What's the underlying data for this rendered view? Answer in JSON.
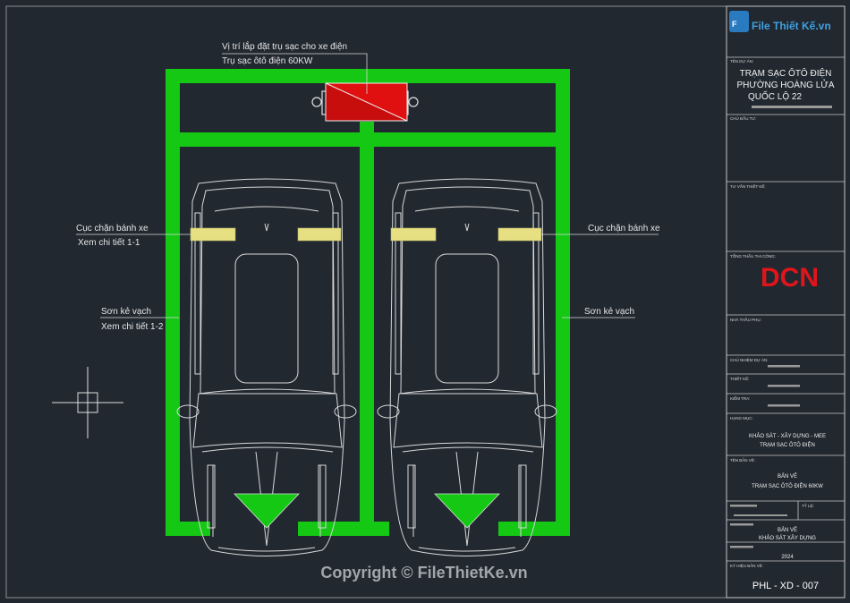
{
  "labels": {
    "charger_location": "Vị trí lắp đặt trụ sạc cho xe điện",
    "charger_spec": "Trụ sạc ôtô điện 60KW",
    "wheel_stop_left": "Cục chặn bánh xe",
    "wheel_stop_left_ref": "Xem chi tiết 1-1",
    "wheel_stop_right": "Cục chặn bánh xe",
    "paint_left": "Sơn kẻ vạch",
    "paint_left_ref": "Xem chi tiết 1-2",
    "paint_right": "Sơn kẻ vạch"
  },
  "title_block": {
    "logo_text": "File Thiết Kế.vn",
    "project_caption": "TÊN DỰ ÁN:",
    "project_line1": "TRẠM SẠC ÔTÔ ĐIỆN",
    "project_line2": "PHƯỜNG HOÀNG LỬA",
    "project_line3": "QUỐC LỘ 22",
    "investor_caption": "CHỦ ĐẦU TƯ:",
    "consultant_caption": "TƯ VẤN THIẾT KẾ:",
    "contractor_caption": "TỔNG THẦU THI CÔNG:",
    "contractor_logo": "DCN",
    "subcontractor_caption": "NHÀ THẦU PHỤ:",
    "manager_caption": "CHỦ NHIỆM DỰ ÁN:",
    "designer_caption": "THIẾT KẾ:",
    "checker_caption": "KIỂM TRA:",
    "category_caption": "HẠNG MỤC:",
    "category_line1": "KHẢO SÁT - XÂY DỰNG - MEE",
    "category_line2": "TRẠM SẠC ÔTÔ ĐIỆN",
    "drawing_caption": "TÊN BẢN VẼ:",
    "drawing_line1": "BẢN VẼ",
    "drawing_line2": "TRẠM SẠC ÔTÔ ĐIỆN 60KW",
    "scale_caption": "TỶ LỆ:",
    "phase_line1": "BẢN VẼ",
    "phase_line2": "KHẢO SÁT XÂY DỰNG",
    "year": "2024",
    "sheet_caption": "KÝ HIỆU BẢN VẼ:",
    "sheet_number": "PHL - XD - 007"
  },
  "watermark": "Copyright © FileThietKe.vn",
  "colors": {
    "background": "#212830",
    "paint_green": "#14c814",
    "charger_red": "#e01010",
    "linework": "#d9d9d9",
    "wheel_stop": "#e6e082",
    "contractor_red": "#e0151b"
  }
}
